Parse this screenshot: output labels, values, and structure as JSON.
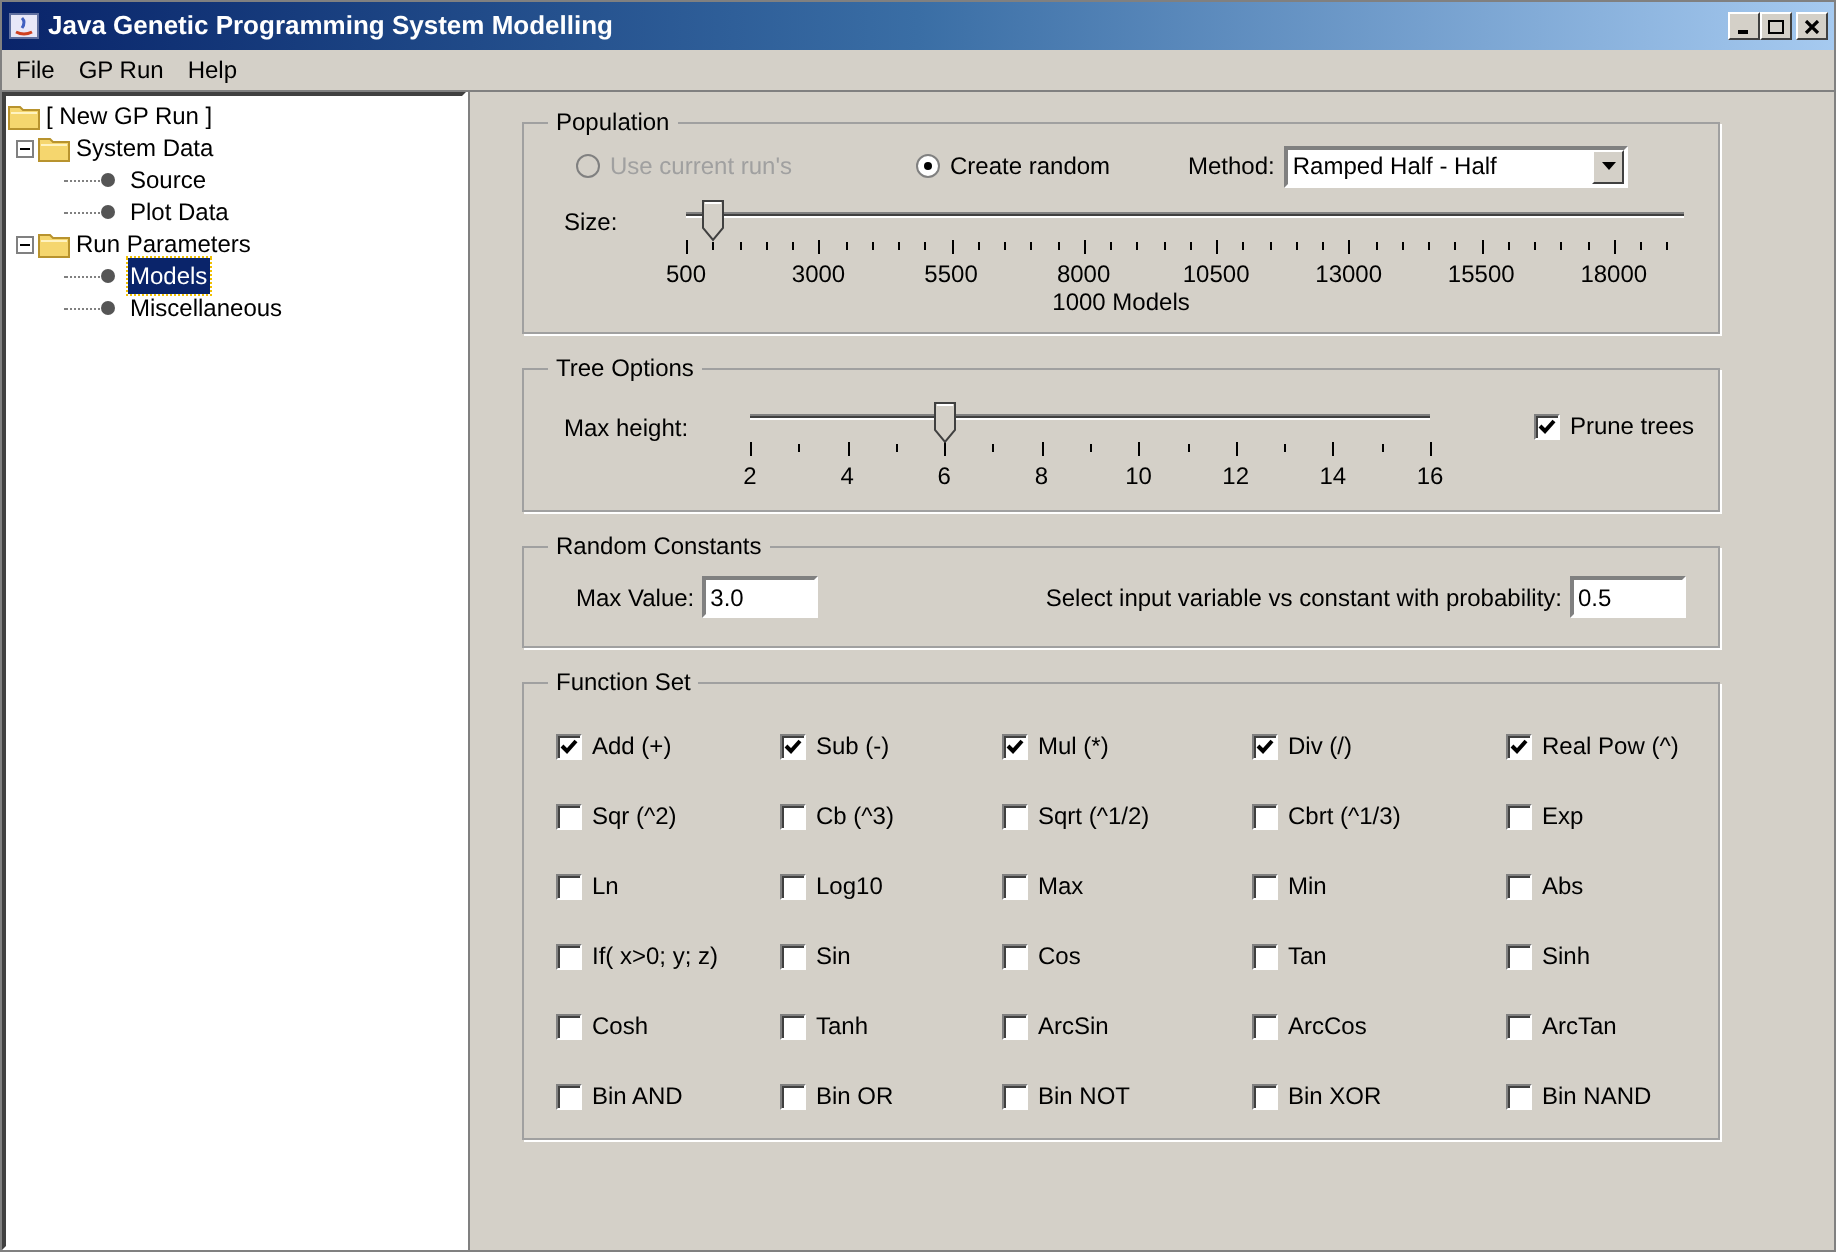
{
  "window": {
    "title": "Java Genetic Programming System Modelling"
  },
  "menu": [
    "File",
    "GP Run",
    "Help"
  ],
  "tree": [
    {
      "label": "[ New GP Run ]",
      "kind": "folder",
      "selected": false,
      "children": [
        {
          "label": "System Data",
          "kind": "folder",
          "expanded": true,
          "selected": false,
          "children": [
            {
              "label": "Source",
              "kind": "leaf",
              "selected": false
            },
            {
              "label": "Plot Data",
              "kind": "leaf",
              "selected": false
            }
          ]
        },
        {
          "label": "Run Parameters",
          "kind": "folder",
          "expanded": true,
          "selected": false,
          "children": [
            {
              "label": "Models",
              "kind": "leaf",
              "selected": true
            },
            {
              "label": "Miscellaneous",
              "kind": "leaf",
              "selected": false
            }
          ]
        }
      ]
    }
  ],
  "population": {
    "title": "Population",
    "options": [
      {
        "label": "Use current run's",
        "selected": false,
        "disabled": true
      },
      {
        "label": "Create random",
        "selected": true,
        "disabled": false
      }
    ],
    "method_label": "Method:",
    "method_value": "Ramped Half - Half",
    "size_label": "Size:",
    "size_slider": {
      "level": 0.026,
      "ticks": [
        "500",
        "3000",
        "5500",
        "8000",
        "10500",
        "13000",
        "15500",
        "18000"
      ]
    },
    "reading": "1000 Models"
  },
  "tree_options": {
    "title": "Tree Options",
    "max_height_label": "Max height:",
    "slider": {
      "level": 0.2857,
      "ticks": [
        "2",
        "4",
        "6",
        "8",
        "10",
        "12",
        "14",
        "16"
      ]
    },
    "prune": {
      "label": "Prune trees",
      "checked": true
    }
  },
  "random_constants": {
    "title": "Random Constants",
    "fields": [
      {
        "label": "Max Value:",
        "value": "3.0"
      },
      {
        "label": "Select input variable vs constant with probability:",
        "value": "0.5"
      }
    ]
  },
  "function_set": {
    "title": "Function Set",
    "items": [
      {
        "label": "Add (+)",
        "checked": true
      },
      {
        "label": "Sub (-)",
        "checked": true
      },
      {
        "label": "Mul (*)",
        "checked": true
      },
      {
        "label": "Div (/)",
        "checked": true
      },
      {
        "label": "Real Pow (^)",
        "checked": true
      },
      {
        "label": "Sqr (^2)",
        "checked": false
      },
      {
        "label": "Cb (^3)",
        "checked": false
      },
      {
        "label": "Sqrt (^1/2)",
        "checked": false
      },
      {
        "label": "Cbrt (^1/3)",
        "checked": false
      },
      {
        "label": "Exp",
        "checked": false
      },
      {
        "label": "Ln",
        "checked": false
      },
      {
        "label": "Log10",
        "checked": false
      },
      {
        "label": "Max",
        "checked": false
      },
      {
        "label": "Min",
        "checked": false
      },
      {
        "label": "Abs",
        "checked": false
      },
      {
        "label": "If( x>0; y; z)",
        "checked": false
      },
      {
        "label": "Sin",
        "checked": false
      },
      {
        "label": "Cos",
        "checked": false
      },
      {
        "label": "Tan",
        "checked": false
      },
      {
        "label": "Sinh",
        "checked": false
      },
      {
        "label": "Cosh",
        "checked": false
      },
      {
        "label": "Tanh",
        "checked": false
      },
      {
        "label": "ArcSin",
        "checked": false
      },
      {
        "label": "ArcCos",
        "checked": false
      },
      {
        "label": "ArcTan",
        "checked": false
      },
      {
        "label": "Bin AND",
        "checked": false
      },
      {
        "label": "Bin OR",
        "checked": false
      },
      {
        "label": "Bin NOT",
        "checked": false
      },
      {
        "label": "Bin XOR",
        "checked": false
      },
      {
        "label": "Bin NAND",
        "checked": false
      }
    ]
  }
}
